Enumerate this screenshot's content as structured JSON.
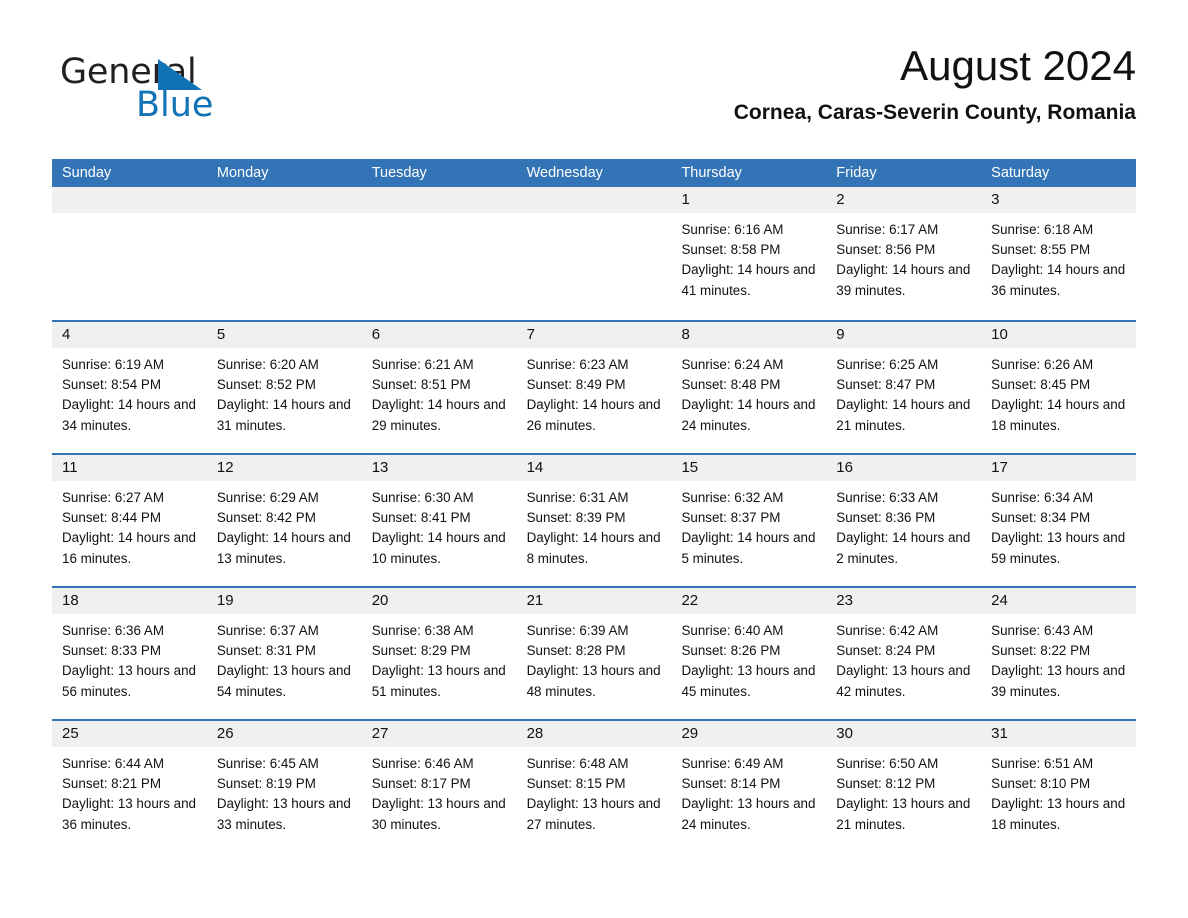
{
  "brand": {
    "word1": "General",
    "word2": "Blue",
    "triangle_color": "#1272b6",
    "logo_icon": "general-blue-logo"
  },
  "header": {
    "month_title": "August 2024",
    "location": "Cornea, Caras-Severin County, Romania"
  },
  "theme": {
    "header_blue": "#3274b5",
    "day_band_gray": "#f0f0f0",
    "text": "#111111",
    "brand_blue": "#1272b6"
  },
  "calendar": {
    "weekday_headers": [
      "Sunday",
      "Monday",
      "Tuesday",
      "Wednesday",
      "Thursday",
      "Friday",
      "Saturday"
    ],
    "labels": {
      "sunrise": "Sunrise:",
      "sunset": "Sunset:",
      "daylight": "Daylight:"
    },
    "weeks": [
      [
        {
          "empty": true,
          "day": "",
          "sunrise": "",
          "sunset": "",
          "daylight": ""
        },
        {
          "empty": true,
          "day": "",
          "sunrise": "",
          "sunset": "",
          "daylight": ""
        },
        {
          "empty": true,
          "day": "",
          "sunrise": "",
          "sunset": "",
          "daylight": ""
        },
        {
          "empty": true,
          "day": "",
          "sunrise": "",
          "sunset": "",
          "daylight": ""
        },
        {
          "empty": false,
          "day": "1",
          "sunrise": "Sunrise: 6:16 AM",
          "sunset": "Sunset: 8:58 PM",
          "daylight": "Daylight: 14 hours and 41 minutes."
        },
        {
          "empty": false,
          "day": "2",
          "sunrise": "Sunrise: 6:17 AM",
          "sunset": "Sunset: 8:56 PM",
          "daylight": "Daylight: 14 hours and 39 minutes."
        },
        {
          "empty": false,
          "day": "3",
          "sunrise": "Sunrise: 6:18 AM",
          "sunset": "Sunset: 8:55 PM",
          "daylight": "Daylight: 14 hours and 36 minutes."
        }
      ],
      [
        {
          "empty": false,
          "day": "4",
          "sunrise": "Sunrise: 6:19 AM",
          "sunset": "Sunset: 8:54 PM",
          "daylight": "Daylight: 14 hours and 34 minutes."
        },
        {
          "empty": false,
          "day": "5",
          "sunrise": "Sunrise: 6:20 AM",
          "sunset": "Sunset: 8:52 PM",
          "daylight": "Daylight: 14 hours and 31 minutes."
        },
        {
          "empty": false,
          "day": "6",
          "sunrise": "Sunrise: 6:21 AM",
          "sunset": "Sunset: 8:51 PM",
          "daylight": "Daylight: 14 hours and 29 minutes."
        },
        {
          "empty": false,
          "day": "7",
          "sunrise": "Sunrise: 6:23 AM",
          "sunset": "Sunset: 8:49 PM",
          "daylight": "Daylight: 14 hours and 26 minutes."
        },
        {
          "empty": false,
          "day": "8",
          "sunrise": "Sunrise: 6:24 AM",
          "sunset": "Sunset: 8:48 PM",
          "daylight": "Daylight: 14 hours and 24 minutes."
        },
        {
          "empty": false,
          "day": "9",
          "sunrise": "Sunrise: 6:25 AM",
          "sunset": "Sunset: 8:47 PM",
          "daylight": "Daylight: 14 hours and 21 minutes."
        },
        {
          "empty": false,
          "day": "10",
          "sunrise": "Sunrise: 6:26 AM",
          "sunset": "Sunset: 8:45 PM",
          "daylight": "Daylight: 14 hours and 18 minutes."
        }
      ],
      [
        {
          "empty": false,
          "day": "11",
          "sunrise": "Sunrise: 6:27 AM",
          "sunset": "Sunset: 8:44 PM",
          "daylight": "Daylight: 14 hours and 16 minutes."
        },
        {
          "empty": false,
          "day": "12",
          "sunrise": "Sunrise: 6:29 AM",
          "sunset": "Sunset: 8:42 PM",
          "daylight": "Daylight: 14 hours and 13 minutes."
        },
        {
          "empty": false,
          "day": "13",
          "sunrise": "Sunrise: 6:30 AM",
          "sunset": "Sunset: 8:41 PM",
          "daylight": "Daylight: 14 hours and 10 minutes."
        },
        {
          "empty": false,
          "day": "14",
          "sunrise": "Sunrise: 6:31 AM",
          "sunset": "Sunset: 8:39 PM",
          "daylight": "Daylight: 14 hours and 8 minutes."
        },
        {
          "empty": false,
          "day": "15",
          "sunrise": "Sunrise: 6:32 AM",
          "sunset": "Sunset: 8:37 PM",
          "daylight": "Daylight: 14 hours and 5 minutes."
        },
        {
          "empty": false,
          "day": "16",
          "sunrise": "Sunrise: 6:33 AM",
          "sunset": "Sunset: 8:36 PM",
          "daylight": "Daylight: 14 hours and 2 minutes."
        },
        {
          "empty": false,
          "day": "17",
          "sunrise": "Sunrise: 6:34 AM",
          "sunset": "Sunset: 8:34 PM",
          "daylight": "Daylight: 13 hours and 59 minutes."
        }
      ],
      [
        {
          "empty": false,
          "day": "18",
          "sunrise": "Sunrise: 6:36 AM",
          "sunset": "Sunset: 8:33 PM",
          "daylight": "Daylight: 13 hours and 56 minutes."
        },
        {
          "empty": false,
          "day": "19",
          "sunrise": "Sunrise: 6:37 AM",
          "sunset": "Sunset: 8:31 PM",
          "daylight": "Daylight: 13 hours and 54 minutes."
        },
        {
          "empty": false,
          "day": "20",
          "sunrise": "Sunrise: 6:38 AM",
          "sunset": "Sunset: 8:29 PM",
          "daylight": "Daylight: 13 hours and 51 minutes."
        },
        {
          "empty": false,
          "day": "21",
          "sunrise": "Sunrise: 6:39 AM",
          "sunset": "Sunset: 8:28 PM",
          "daylight": "Daylight: 13 hours and 48 minutes."
        },
        {
          "empty": false,
          "day": "22",
          "sunrise": "Sunrise: 6:40 AM",
          "sunset": "Sunset: 8:26 PM",
          "daylight": "Daylight: 13 hours and 45 minutes."
        },
        {
          "empty": false,
          "day": "23",
          "sunrise": "Sunrise: 6:42 AM",
          "sunset": "Sunset: 8:24 PM",
          "daylight": "Daylight: 13 hours and 42 minutes."
        },
        {
          "empty": false,
          "day": "24",
          "sunrise": "Sunrise: 6:43 AM",
          "sunset": "Sunset: 8:22 PM",
          "daylight": "Daylight: 13 hours and 39 minutes."
        }
      ],
      [
        {
          "empty": false,
          "day": "25",
          "sunrise": "Sunrise: 6:44 AM",
          "sunset": "Sunset: 8:21 PM",
          "daylight": "Daylight: 13 hours and 36 minutes."
        },
        {
          "empty": false,
          "day": "26",
          "sunrise": "Sunrise: 6:45 AM",
          "sunset": "Sunset: 8:19 PM",
          "daylight": "Daylight: 13 hours and 33 minutes."
        },
        {
          "empty": false,
          "day": "27",
          "sunrise": "Sunrise: 6:46 AM",
          "sunset": "Sunset: 8:17 PM",
          "daylight": "Daylight: 13 hours and 30 minutes."
        },
        {
          "empty": false,
          "day": "28",
          "sunrise": "Sunrise: 6:48 AM",
          "sunset": "Sunset: 8:15 PM",
          "daylight": "Daylight: 13 hours and 27 minutes."
        },
        {
          "empty": false,
          "day": "29",
          "sunrise": "Sunrise: 6:49 AM",
          "sunset": "Sunset: 8:14 PM",
          "daylight": "Daylight: 13 hours and 24 minutes."
        },
        {
          "empty": false,
          "day": "30",
          "sunrise": "Sunrise: 6:50 AM",
          "sunset": "Sunset: 8:12 PM",
          "daylight": "Daylight: 13 hours and 21 minutes."
        },
        {
          "empty": false,
          "day": "31",
          "sunrise": "Sunrise: 6:51 AM",
          "sunset": "Sunset: 8:10 PM",
          "daylight": "Daylight: 13 hours and 18 minutes."
        }
      ]
    ]
  }
}
